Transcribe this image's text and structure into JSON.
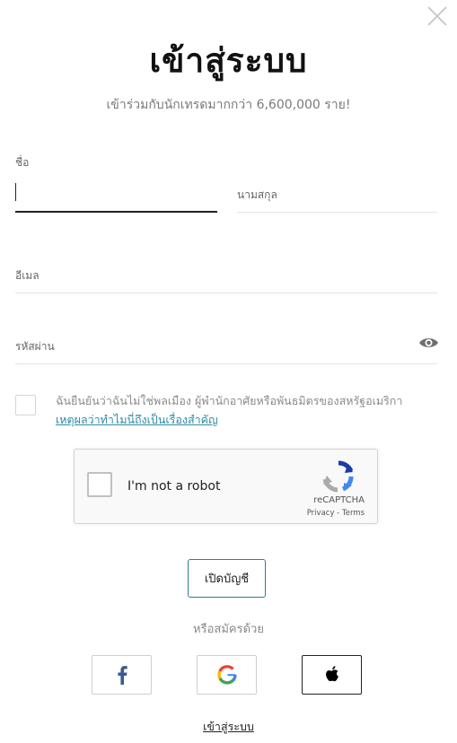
{
  "header": {
    "title": "เข้าสู่ระบบ",
    "subtitle": "เข้าร่วมกับนักเทรดมากกว่า 6,600,000 ราย!"
  },
  "form": {
    "first_name": {
      "label": "ชื่อ",
      "value": ""
    },
    "last_name": {
      "placeholder": "นามสกุล"
    },
    "email": {
      "placeholder": "อีเมล"
    },
    "password": {
      "placeholder": "รหัสผ่าน"
    }
  },
  "declaration": {
    "text": "ฉันยืนยันว่าฉันไม่ใช่พลเมือง ผู้พำนักอาศัยหรือพันธมิตรของสหรัฐอเมริกา",
    "link": "เหตุผลว่าทำไมนี่ถึงเป็นเรื่องสำคัญ",
    "checked": false
  },
  "recaptcha": {
    "label": "I'm not a robot",
    "brand": "reCAPTCHA",
    "privacy": "Privacy",
    "separator": " - ",
    "terms": "Terms"
  },
  "actions": {
    "open_account": "เปิดบัญชี",
    "or_register_with": "หรือสมัครด้วย",
    "login": "เข้าสู่ระบบ"
  },
  "social": [
    {
      "name": "facebook",
      "icon": "facebook-icon",
      "color": "#3b5998"
    },
    {
      "name": "google",
      "icon": "google-icon"
    },
    {
      "name": "apple",
      "icon": "apple-icon",
      "color": "#000000"
    }
  ],
  "colors": {
    "accent": "#2f7d99",
    "link": "#2f8aa6"
  }
}
